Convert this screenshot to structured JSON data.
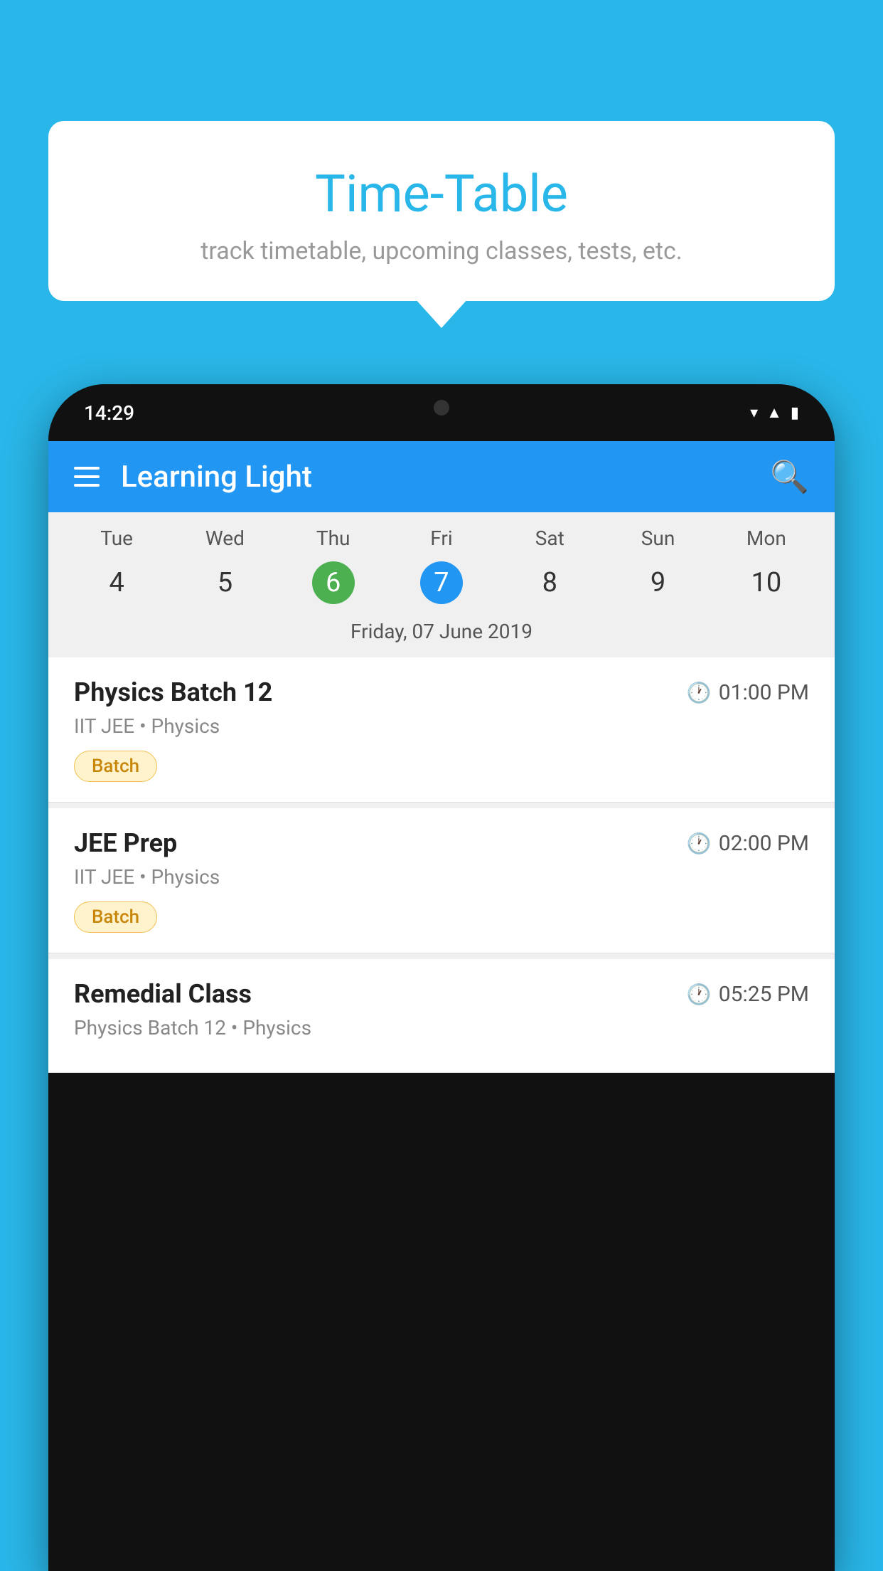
{
  "background_color": "#29b6e8",
  "tooltip": {
    "title": "Time-Table",
    "subtitle": "track timetable, upcoming classes, tests, etc."
  },
  "phone": {
    "status_bar": {
      "time": "14:29"
    },
    "app_header": {
      "title": "Learning Light",
      "menu_icon": "hamburger-icon",
      "search_icon": "search-icon"
    },
    "calendar": {
      "day_headers": [
        "Tue",
        "Wed",
        "Thu",
        "Fri",
        "Sat",
        "Sun",
        "Mon"
      ],
      "day_numbers": [
        "4",
        "5",
        "6",
        "7",
        "8",
        "9",
        "10"
      ],
      "today_index": 2,
      "selected_index": 3,
      "selected_date_label": "Friday, 07 June 2019"
    },
    "classes": [
      {
        "name": "Physics Batch 12",
        "time": "01:00 PM",
        "meta": "IIT JEE • Physics",
        "tag": "Batch"
      },
      {
        "name": "JEE Prep",
        "time": "02:00 PM",
        "meta": "IIT JEE • Physics",
        "tag": "Batch"
      },
      {
        "name": "Remedial Class",
        "time": "05:25 PM",
        "meta": "Physics Batch 12 • Physics",
        "tag": ""
      }
    ]
  }
}
